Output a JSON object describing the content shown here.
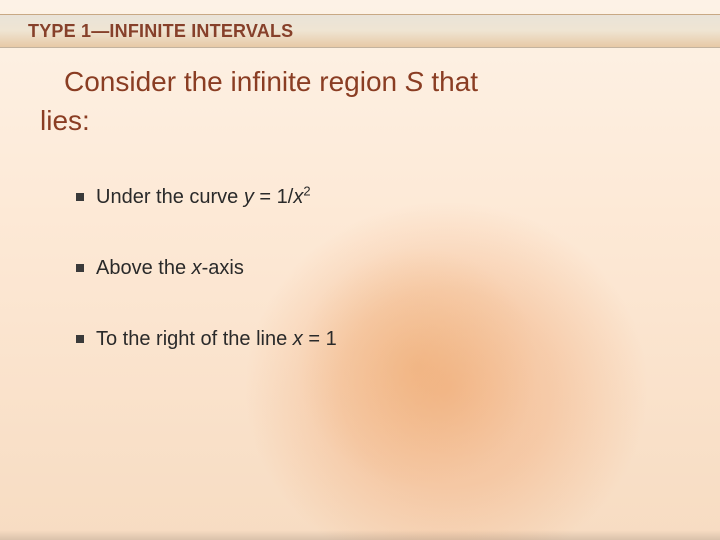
{
  "title": "TYPE 1—INFINITE INTERVALS",
  "lead": {
    "line1_prefix": "Consider the infinite region ",
    "line1_italic": "S",
    "line1_suffix": " that",
    "line2": "lies:"
  },
  "bullets": {
    "b1_prefix": "Under the curve ",
    "b1_y": "y",
    "b1_eq": " = 1/",
    "b1_x": "x",
    "b1_sup": "2",
    "b2_prefix": "Above the ",
    "b2_x": "x",
    "b2_suffix": "-axis",
    "b3_prefix": "To the right of the line ",
    "b3_x": "x",
    "b3_suffix": " = 1"
  }
}
